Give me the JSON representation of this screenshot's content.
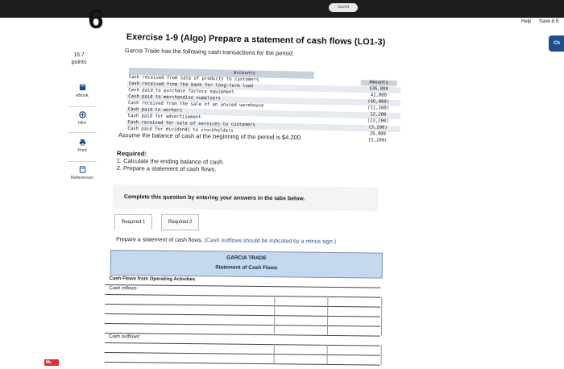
{
  "topbar": {
    "saved_label": "Saved"
  },
  "header": {
    "help_label": "Help",
    "save_exit_label": "Save & E",
    "check_label": "Ch"
  },
  "question": {
    "number": "6",
    "points_value": "16.7",
    "points_label": "points"
  },
  "sidebar": {
    "items": [
      {
        "label": "eBook",
        "icon": "book-icon"
      },
      {
        "label": "Hint",
        "icon": "hint-icon"
      },
      {
        "label": "Print",
        "icon": "printer-icon"
      },
      {
        "label": "References",
        "icon": "references-icon"
      }
    ]
  },
  "exercise": {
    "title": "Exercise 1-9 (Algo) Prepare a statement of cash flows (LO1-3)",
    "intro": "Garcia Trade has the following cash transactions for the period.",
    "accounts_header": "Accounts",
    "amounts_header": "Amounts",
    "transactions": [
      {
        "desc": "Cash received from sale of products to customers",
        "amount": "$36,000"
      },
      {
        "desc": "Cash received from the bank for long-term loan",
        "amount": "41,000"
      },
      {
        "desc": "Cash paid to purchase factory equipment",
        "amount": "(46,000)"
      },
      {
        "desc": "Cash paid to merchandise suppliers",
        "amount": "(11,200)"
      },
      {
        "desc": "Cash received from the sale of an unused warehouse",
        "amount": "12,200"
      },
      {
        "desc": "Cash paid to workers",
        "amount": "(23,200)"
      },
      {
        "desc": "Cash paid for advertisement",
        "amount": "(3,200)"
      },
      {
        "desc": "Cash received for sale of services to customers",
        "amount": "26,000"
      },
      {
        "desc": "Cash paid for dividends to stockholders",
        "amount": "(5,200)"
      }
    ],
    "assume": "Assume the balance of cash at the beginning of the period is $4,200.",
    "required_title": "Required:",
    "required_items": [
      "1. Calculate the ending balance of cash.",
      "2. Prepare a statement of cash flows."
    ]
  },
  "answer": {
    "complete_text": "Complete this question by entering your answers in the tabs below.",
    "tabs": [
      "Required 1",
      "Required 2"
    ],
    "instruction_main": "Prepare a statement of cash flows.",
    "instruction_note": "(Cash outflows should be indicated by a minus sign.)",
    "statement": {
      "company": "GARCIA TRADE",
      "title": "Statement of Cash Flows",
      "section_operating": "Cash Flows from Operating Activities",
      "cash_inflows_label": "Cash inflows:",
      "cash_outflows_label": "Cash outflows:"
    }
  },
  "colors": {
    "topbar": "#1d1d1f",
    "header_fill": "#c6d8ef",
    "check_button": "#1b4e8a"
  }
}
